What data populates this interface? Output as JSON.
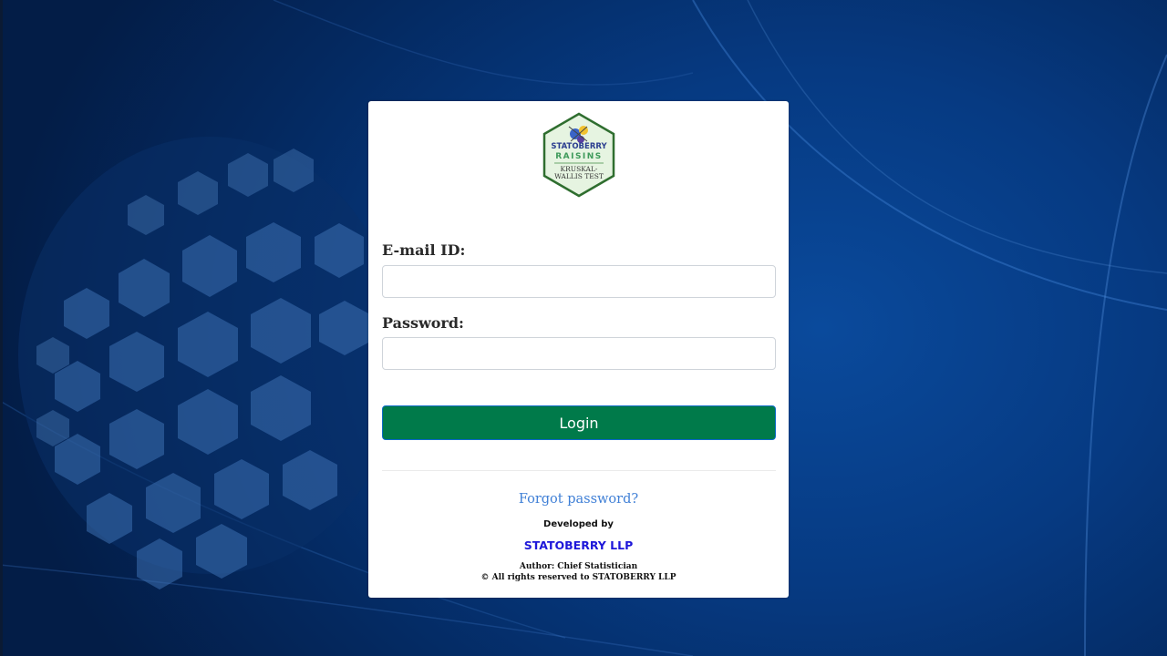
{
  "logo": {
    "brand_top": "STATOBERRY",
    "product": "RAISINS",
    "test_line1": "KRUSKAL-",
    "test_line2": "WALLIS TEST"
  },
  "form": {
    "email_label": "E-mail ID:",
    "email_value": "",
    "password_label": "Password:",
    "password_value": "",
    "login_label": "Login"
  },
  "footer": {
    "forgot_label": "Forgot password?",
    "developed_by": "Developed by",
    "company": "STATOBERRY LLP",
    "author": "Author: Chief Statistician",
    "rights": "© All rights reserved to STATOBERRY LLP"
  },
  "colors": {
    "background": "#063a82",
    "login_button": "#007a4a",
    "link": "#3f7fd6",
    "company": "#1e17d9",
    "logo_border": "#2f6e2f",
    "logo_fill": "#e6f4e1"
  },
  "icons": {
    "logo": "statoberry-hexagon-logo"
  }
}
